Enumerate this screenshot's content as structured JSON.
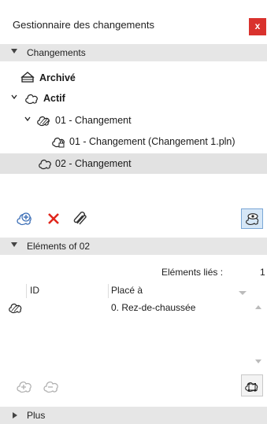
{
  "window": {
    "title": "Gestionnaire des changements",
    "close_label": "x"
  },
  "changes_section": {
    "label": "Changements"
  },
  "tree": [
    {
      "label": "Archivé",
      "icon": "archive-icon"
    },
    {
      "label": "Actif",
      "icon": "cloud-icon"
    },
    {
      "label": "01 - Changement",
      "icon": "hatched-cloud-icon"
    },
    {
      "label": "01 - Changement (Changement 1.pln)",
      "icon": "locked-cloud-icon"
    },
    {
      "label": "02 - Changement",
      "icon": "cloud-icon"
    }
  ],
  "elements_section": {
    "label": "Eléments of 02"
  },
  "table": {
    "linked_label": "Eléments liés :",
    "linked_count": "1",
    "columns": [
      "ID",
      "Placé à"
    ],
    "rows": [
      {
        "id": "",
        "placed": "0. Rez-de-chaussée"
      }
    ]
  },
  "more_section": {
    "label": "Plus"
  },
  "colors": {
    "close_bg": "#d9322d",
    "delete_red": "#e0261c",
    "selected_row": "#e2e2e2",
    "toggle_bg": "#d6e7f7"
  }
}
